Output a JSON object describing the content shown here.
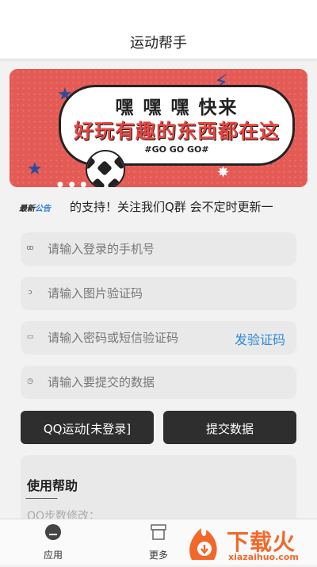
{
  "header": {
    "title": "运动帮手"
  },
  "banner": {
    "line1": "嘿 嘿 嘿 快来",
    "line2": "好玩有趣的东西都在这",
    "line3": "#GO GO GO#",
    "dots": "● ● ●"
  },
  "notice": {
    "badge_a": "最新",
    "badge_b": "公告",
    "text": "的支持！关注我们Q群 会不定时更新一"
  },
  "form": {
    "phone_placeholder": "请输入登录的手机号",
    "captcha_placeholder": "请输入图片验证码",
    "password_placeholder": "请输入密码或短信验证码",
    "send_code_label": "发验证码",
    "data_placeholder": "请输入要提交的数据",
    "qq_sport_label": "QQ运动[未登录]",
    "submit_label": "提交数据"
  },
  "help": {
    "title": "使用帮助",
    "divider": "------------",
    "first_item": "QQ步数修改："
  },
  "tabs": [
    {
      "label": "应用",
      "icon": "app-icon"
    },
    {
      "label": "更多",
      "icon": "box-icon"
    }
  ],
  "watermark": {
    "brand": "下载火",
    "url": "xiazaihuo.com"
  },
  "colors": {
    "banner_bg": "#e45a55",
    "link_blue": "#2f8ad8",
    "button_dark": "#2e2e2e"
  }
}
